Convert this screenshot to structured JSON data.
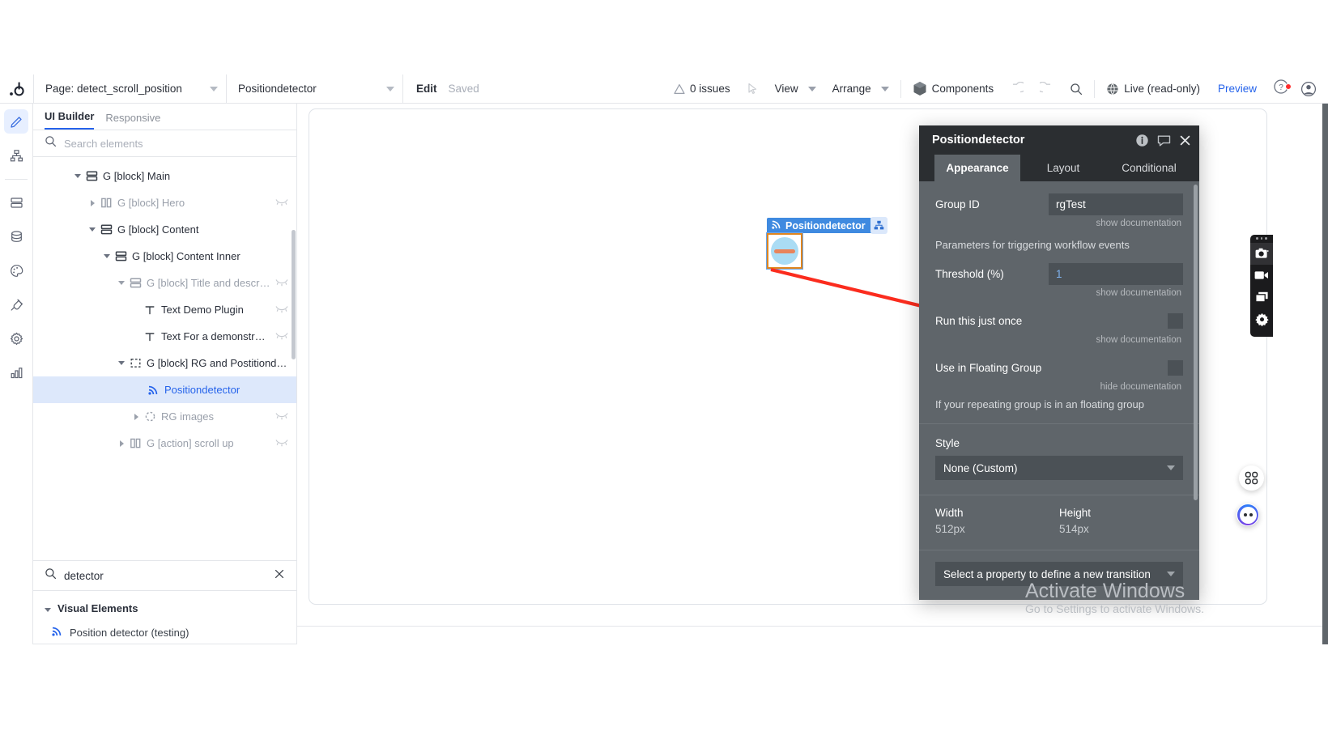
{
  "topbar": {
    "logo_icon": "bubble-logo-icon",
    "page_selector": {
      "label": "Page: detect_scroll_position",
      "caret_icon": "chevron-down-icon"
    },
    "element_selector": {
      "label": "Positiondetector",
      "caret_icon": "chevron-down-icon"
    },
    "edit_label": "Edit",
    "saved_label": "Saved",
    "issues_label": "0 issues",
    "issues_icon": "warning-triangle-icon",
    "cursor_icon": "cursor-pointer-icon",
    "view_label": "View",
    "arrange_label": "Arrange",
    "components_label": "Components",
    "components_icon": "cube-icon",
    "undo_icon": "undo-icon",
    "redo_icon": "redo-icon",
    "search_icon": "search-icon",
    "live_label": "Live (read-only)",
    "live_icon": "globe-icon",
    "preview_label": "Preview",
    "help_icon": "help-question-icon",
    "avatar_icon": "user-avatar-icon"
  },
  "rail": {
    "items": [
      {
        "name": "design",
        "icon": "pencil-icon",
        "active": true
      },
      {
        "name": "workflow",
        "icon": "sitemap-icon",
        "active": false
      },
      {
        "name": "data-blocks",
        "icon": "server-icon",
        "active": false
      },
      {
        "name": "database",
        "icon": "database-icon",
        "active": false
      },
      {
        "name": "styles",
        "icon": "palette-icon",
        "active": false
      },
      {
        "name": "plugins",
        "icon": "plug-icon",
        "active": false
      },
      {
        "name": "settings",
        "icon": "gear-icon",
        "active": false
      },
      {
        "name": "logs",
        "icon": "bar-chart-icon",
        "active": false
      }
    ]
  },
  "left_panel": {
    "tabs": [
      {
        "label": "UI Builder",
        "active": true
      },
      {
        "label": "Responsive",
        "active": false
      }
    ],
    "search": {
      "placeholder": "Search elements",
      "value": "",
      "icon": "search-icon"
    },
    "tree": [
      {
        "label": "G [block] Main",
        "indent": 0,
        "twisty": "down",
        "icon": "block-stack-icon",
        "dim": false,
        "selected": false,
        "eye": false
      },
      {
        "label": "G [block] Hero",
        "indent": 1,
        "twisty": "right",
        "icon": "columns-icon",
        "dim": true,
        "selected": false,
        "eye": true
      },
      {
        "label": "G [block] Content",
        "indent": 1,
        "twisty": "down",
        "icon": "block-stack-icon",
        "dim": false,
        "selected": false,
        "eye": false
      },
      {
        "label": "G [block] Content Inner",
        "indent": 2,
        "twisty": "down",
        "icon": "block-stack-icon",
        "dim": false,
        "selected": false,
        "eye": false
      },
      {
        "label": "G [block] Title and descript...",
        "indent": 3,
        "twisty": "down",
        "icon": "block-stack-icon",
        "dim": true,
        "selected": false,
        "eye": true
      },
      {
        "label": "Text Demo Plugin",
        "indent": 4,
        "twisty": "none",
        "icon": "text-icon",
        "dim": false,
        "selected": false,
        "eye": true
      },
      {
        "label": "Text For a demonstration",
        "indent": 4,
        "twisty": "none",
        "icon": "text-icon",
        "dim": false,
        "selected": false,
        "eye": true
      },
      {
        "label": "G [block] RG and Postitiondetector",
        "indent": 3,
        "twisty": "down",
        "icon": "dashed-box-icon",
        "dim": false,
        "selected": false,
        "eye": false
      },
      {
        "label": "Positiondetector",
        "indent": 4,
        "twisty": "none",
        "icon": "rss-icon",
        "dim": false,
        "selected": true,
        "eye": false
      },
      {
        "label": "RG images",
        "indent": 4,
        "twisty": "right",
        "icon": "dashed-circle-icon",
        "dim": true,
        "selected": false,
        "eye": true
      },
      {
        "label": "G [action] scroll up",
        "indent": 3,
        "twisty": "right",
        "icon": "columns-icon",
        "dim": true,
        "selected": false,
        "eye": true
      }
    ],
    "element_search": {
      "value": "detector",
      "icon": "search-icon",
      "clear_icon": "close-x-icon"
    },
    "results_group": {
      "label": "Visual Elements",
      "twisty_icon": "chevron-down-icon"
    },
    "results": [
      {
        "label": "Position detector (testing)",
        "icon": "rss-icon"
      }
    ]
  },
  "canvas": {
    "widget": {
      "label": "Positiondetector",
      "label_icon": "rss-icon",
      "badge_icon": "group-nodes-icon"
    }
  },
  "property_panel": {
    "title": "Positiondetector",
    "header_icons": [
      "info-circle-icon",
      "comment-bubble-icon",
      "close-x-icon"
    ],
    "tabs": [
      {
        "label": "Appearance",
        "active": true
      },
      {
        "label": "Layout",
        "active": false
      },
      {
        "label": "Conditional",
        "active": false
      }
    ],
    "fields": {
      "group_id": {
        "label": "Group ID",
        "value": "rgTest",
        "doc": "show documentation"
      },
      "params_note": "Parameters for triggering workflow events",
      "threshold": {
        "label": "Threshold (%)",
        "value": "1",
        "doc": "show documentation"
      },
      "run_once": {
        "label": "Run this just once",
        "value": "",
        "doc": "show documentation"
      },
      "floating_group": {
        "label": "Use in Floating Group",
        "value": "",
        "doc": "hide documentation",
        "help": "If your repeating group is in an floating group"
      }
    },
    "style": {
      "label": "Style",
      "value": "None (Custom)",
      "caret_icon": "chevron-down-icon"
    },
    "width": {
      "label": "Width",
      "value": "512px"
    },
    "height": {
      "label": "Height",
      "value": "514px"
    },
    "transition": {
      "label": "Select a property to define a new transition",
      "caret_icon": "chevron-down-icon"
    }
  },
  "recorder": {
    "menu_icon": "more-dots-icon",
    "buttons": [
      {
        "name": "screenshot",
        "icon": "camera-icon",
        "selected": true
      },
      {
        "name": "record-video",
        "icon": "video-camera-icon",
        "selected": false
      },
      {
        "name": "capture-window",
        "icon": "window-icon",
        "selected": false
      },
      {
        "name": "recorder-settings",
        "icon": "gear-icon",
        "selected": false
      }
    ]
  },
  "fabs": {
    "apps": {
      "icon": "apps-grid-icon"
    },
    "chat": {
      "icon": "chat-avatar-icon"
    }
  },
  "watermark": {
    "line1": "Activate Windows",
    "line2": "Go to Settings to activate Windows."
  }
}
